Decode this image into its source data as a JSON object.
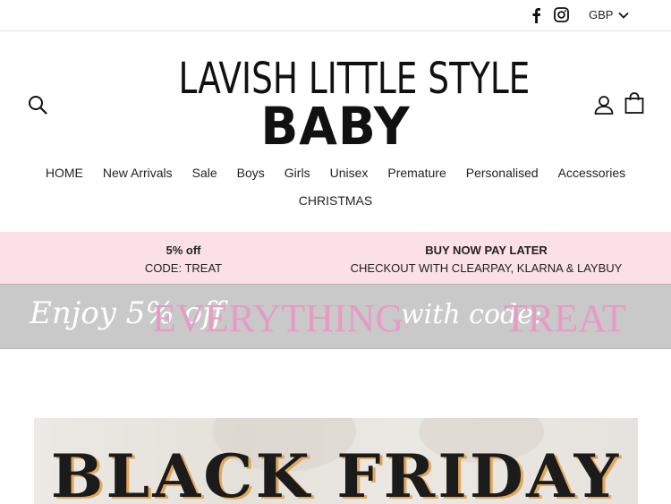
{
  "topbar": {
    "facebook_icon": "facebook-icon",
    "instagram_icon": "instagram-icon",
    "currency": "GBP"
  },
  "header": {
    "logo_line1": "LAVISH LITTLE STYLE",
    "logo_line2": "BABY"
  },
  "nav": {
    "items": [
      "HOME",
      "New Arrivals",
      "Sale",
      "Boys",
      "Girls",
      "Unisex",
      "Premature",
      "Personalised",
      "Accessories"
    ],
    "row2_items": [
      "CHRISTMAS"
    ]
  },
  "promo": {
    "left_title": "5% off",
    "left_sub": "CODE: TREAT",
    "right_title": "BUY NOW PAY LATER",
    "right_sub": "CHECKOUT WITH CLEARPAY, KLARNA & LAYBUY"
  },
  "banner": {
    "script1": "Enjoy 5% off",
    "big1": "EVERYTHING",
    "script2": "with code:",
    "big2": "TREAT"
  },
  "hero": {
    "title": "BLACK FRIDAY"
  },
  "colors": {
    "promo_bg": "#fbe0e8",
    "banner_bg": "#c9c9c9",
    "banner_accent": "#e69bc5",
    "hero_shadow": "#e2a85c"
  }
}
